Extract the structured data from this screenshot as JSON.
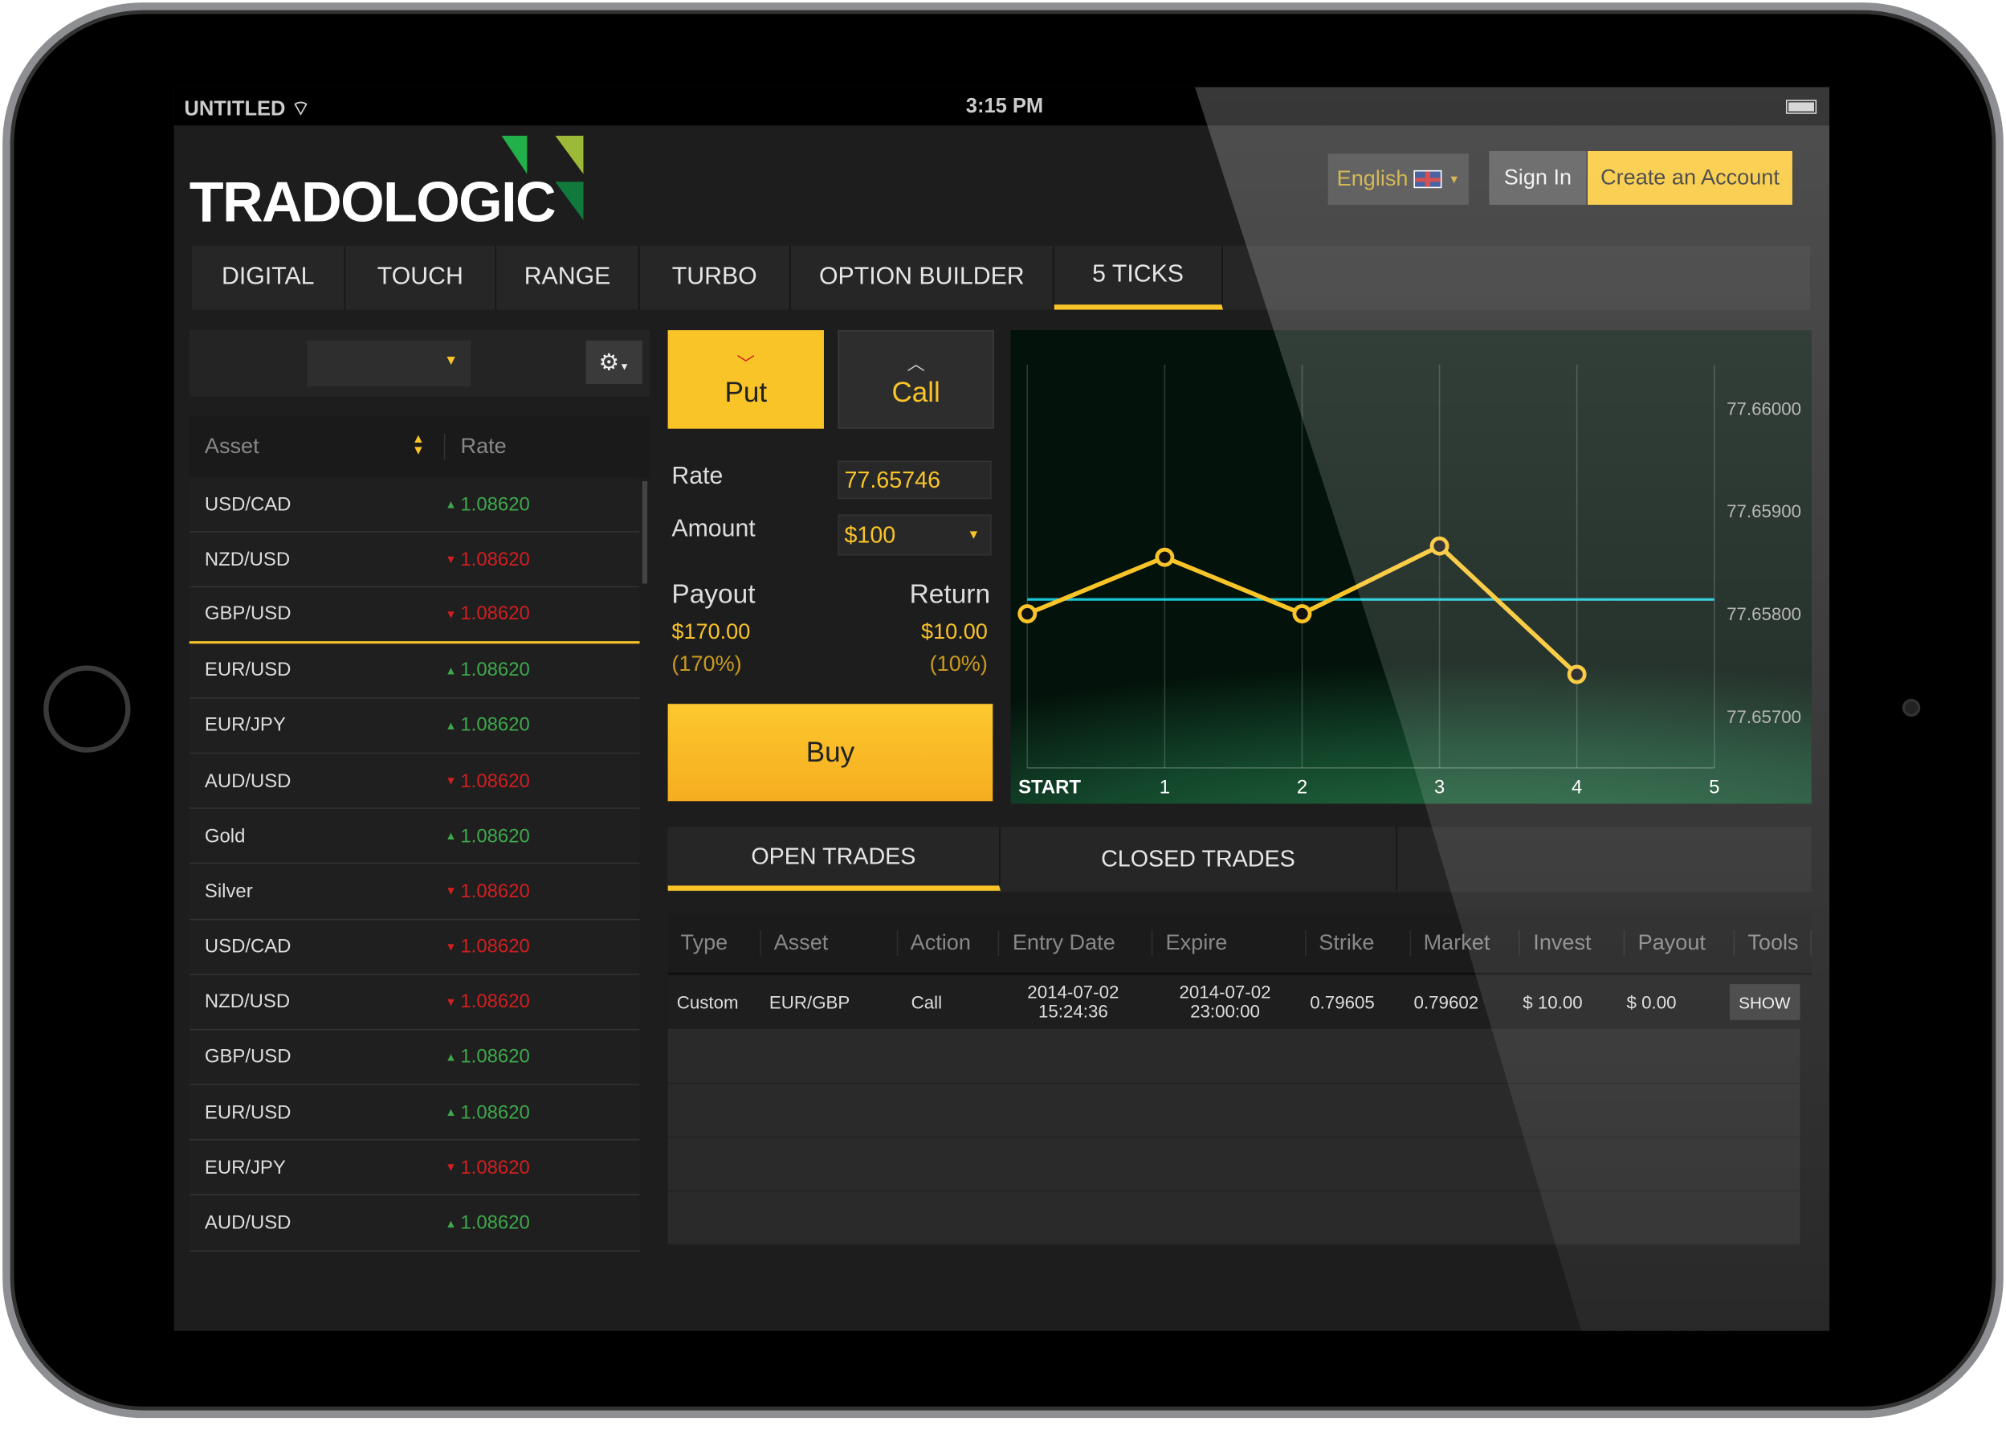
{
  "status": {
    "carrier": "UNTITLED",
    "time": "3:15 PM"
  },
  "brand": {
    "logo_text": "TRADOLOGIC",
    "logo_colors": [
      "#22b04b",
      "#9cba38",
      "#0f7a3c"
    ]
  },
  "header": {
    "language": "English",
    "sign_in": "Sign In",
    "create_account": "Create an Account"
  },
  "tabs": [
    {
      "label": "DIGITAL"
    },
    {
      "label": "TOUCH"
    },
    {
      "label": "RANGE"
    },
    {
      "label": "TURBO"
    },
    {
      "label": "OPTION BUILDER"
    },
    {
      "label": "5 TICKS",
      "active": true
    }
  ],
  "assets": {
    "header_asset": "Asset",
    "header_rate": "Rate",
    "selected_index": 2,
    "rows": [
      {
        "name": "USD/CAD",
        "rate": "1.08620",
        "dir": "up"
      },
      {
        "name": "NZD/USD",
        "rate": "1.08620",
        "dir": "down"
      },
      {
        "name": "GBP/USD",
        "rate": "1.08620",
        "dir": "down"
      },
      {
        "name": "EUR/USD",
        "rate": "1.08620",
        "dir": "up"
      },
      {
        "name": "EUR/JPY",
        "rate": "1.08620",
        "dir": "up"
      },
      {
        "name": "AUD/USD",
        "rate": "1.08620",
        "dir": "down"
      },
      {
        "name": "Gold",
        "rate": "1.08620",
        "dir": "up"
      },
      {
        "name": "Silver",
        "rate": "1.08620",
        "dir": "down"
      },
      {
        "name": "USD/CAD",
        "rate": "1.08620",
        "dir": "down"
      },
      {
        "name": "NZD/USD",
        "rate": "1.08620",
        "dir": "down"
      },
      {
        "name": "GBP/USD",
        "rate": "1.08620",
        "dir": "up"
      },
      {
        "name": "EUR/USD",
        "rate": "1.08620",
        "dir": "up"
      },
      {
        "name": "EUR/JPY",
        "rate": "1.08620",
        "dir": "down"
      },
      {
        "name": "AUD/USD",
        "rate": "1.08620",
        "dir": "up"
      }
    ]
  },
  "trade": {
    "put": "Put",
    "call": "Call",
    "rate_label": "Rate",
    "rate": "77.65746",
    "amount_label": "Amount",
    "amount": "$100",
    "payout_label": "Payout",
    "payout": "$170.00",
    "payout_pct": "(170%)",
    "return_label": "Return",
    "return": "$10.00",
    "return_pct": "(10%)",
    "buy": "Buy"
  },
  "chart_data": {
    "type": "line",
    "x": [
      "START",
      "1",
      "2",
      "3",
      "4",
      "5"
    ],
    "values": [
      77.658,
      77.65855,
      77.658,
      77.65866,
      77.65741,
      null
    ],
    "strike": 77.65814,
    "yticks": [
      "77.66000",
      "77.65900",
      "77.65800",
      "77.65700"
    ],
    "ylim": [
      77.6565,
      77.6603
    ],
    "line_color": "#f9c428",
    "strike_color": "#18c8d8",
    "grid": true
  },
  "trades": {
    "tabs": [
      "OPEN TRADES",
      "CLOSED TRADES"
    ],
    "columns": [
      "Type",
      "Asset",
      "Action",
      "Entry Date",
      "Expire",
      "Strike",
      "Market",
      "Invest",
      "Payout",
      "Tools"
    ],
    "rows": [
      {
        "type": "Custom",
        "asset": "EUR/GBP",
        "action": "Call",
        "entry": "2014-07-02",
        "entry_time": "15:24:36",
        "expire": "2014-07-02",
        "expire_time": "23:00:00",
        "strike": "0.79605",
        "market": "0.79602",
        "invest": "$ 10.00",
        "payout": "$ 0.00",
        "tool": "SHOW"
      }
    ]
  }
}
